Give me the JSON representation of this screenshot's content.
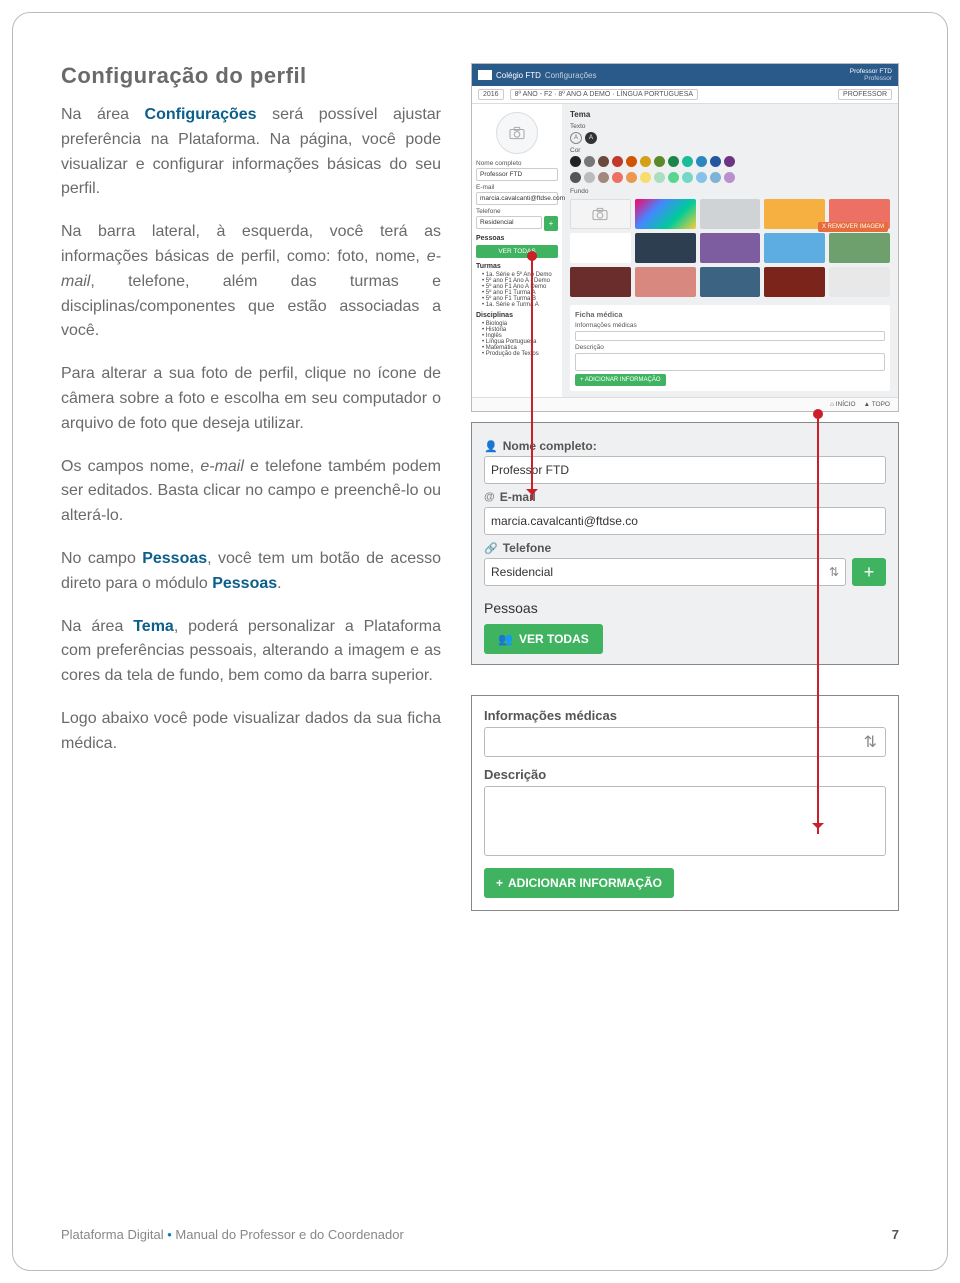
{
  "title": "Configuração do perfil",
  "paragraphs": {
    "p1a": "Na área ",
    "p1_hl": "Configurações",
    "p1b": " será possível ajustar preferência na Plataforma. Na página, você pode visualizar e configurar informações básicas do seu perfil.",
    "p2a": "Na barra lateral, à esquerda, você terá as informações básicas de perfil, como: foto, nome, ",
    "p2_it": "e-mail",
    "p2b": ", telefone, além das turmas e disciplinas/componentes que estão associadas a você.",
    "p3": "Para alterar a sua foto de perfil, clique no ícone de câmera sobre a foto e escolha em seu computador o arquivo de foto que deseja utilizar.",
    "p4a": "Os campos nome, ",
    "p4_it": "e-mail",
    "p4b": " e telefone também podem ser editados. Basta clicar no campo e preenchê-lo ou alterá-lo.",
    "p5a": "No campo ",
    "p5_hl1": "Pessoas",
    "p5b": ", você tem um botão de acesso direto para o módulo ",
    "p5_hl2": "Pessoas",
    "p5c": ".",
    "p6a": "Na área ",
    "p6_hl": "Tema",
    "p6b": ", poderá personalizar a Plataforma com preferências pessoais, alterando a imagem e as cores da tela de fundo, bem como da barra superior.",
    "p7": "Logo abaixo você pode visualizar dados da sua ficha médica."
  },
  "app": {
    "brand": "Colégio FTD",
    "breadcrumb": "Configurações",
    "user": "Professor FTD",
    "role_sub": "Professor",
    "year_pill": "2016",
    "class_pill": "8º ANO - F2 · 8º ANO A DEMO · LÍNGUA PORTUGUESA",
    "role_pill": "PROFESSOR",
    "side": {
      "nome_label": "Nome completo",
      "nome_value": "Professor FTD",
      "email_label": "E-mail",
      "email_value": "marcia.cavalcanti@ftdse.com",
      "tel_label": "Telefone",
      "tel_value": "Residencial",
      "pessoas_title": "Pessoas",
      "ver_todas": "VER TODAS",
      "turmas_title": "Turmas",
      "turmas": [
        "1a. Série e 5º Ano Demo",
        "5º ano F1 Ano A - Demo",
        "5º ano F1 Ano A Demo",
        "5º ano F1 Turma A",
        "5º ano F1 Turma B",
        "1a. Série e Turma A"
      ],
      "disciplinas_title": "Disciplinas",
      "disciplinas": [
        "Biologia",
        "História",
        "Inglês",
        "Língua Portuguesa",
        "Matemática",
        "Produção de Textos"
      ]
    },
    "main": {
      "tema_title": "Tema",
      "texto_label": "Texto",
      "size_a": "A",
      "size_b": "A",
      "cor_label": "Cor",
      "fundo_label": "Fundo",
      "remove_img": "X REMOVER IMAGEM",
      "ficha_title": "Ficha médica",
      "info_label": "Informações médicas",
      "desc_label": "Descrição",
      "add_info": "+ ADICIONAR INFORMAÇÃO",
      "inicio": "INÍCIO",
      "topo": "TOPO"
    },
    "colors_row1": [
      "#222",
      "#777",
      "#6a4a3a",
      "#c0392b",
      "#d35400",
      "#d4a017",
      "#5a8a2a",
      "#1e8449",
      "#1abc9c",
      "#2e86c1",
      "#2456a0",
      "#6c3483"
    ],
    "colors_row2": [
      "#555",
      "#bbb",
      "#a1887f",
      "#ec7063",
      "#eb984e",
      "#f7dc6f",
      "#a9dfbf",
      "#58d68d",
      "#76d7c4",
      "#85c1e9",
      "#7fb3d5",
      "#bb8fce"
    ],
    "bg_tiles": [
      "camera",
      "poly",
      "#d0d3d6",
      "#f5b041",
      "#ec7063",
      "#fff",
      "#2c3e50",
      "#7e5ca0",
      "#5dade2",
      "#6ea06e",
      "#6b2c2c",
      "#d98880",
      "#3c6382",
      "#7b241c",
      "#e8e8e8"
    ]
  },
  "zoom1": {
    "nome_label": "Nome completo:",
    "nome_value": "Professor FTD",
    "email_label": "E-mail",
    "email_value": "marcia.cavalcanti@ftdse.co",
    "tel_label": "Telefone",
    "tel_value": "Residencial",
    "pessoas_title": "Pessoas",
    "ver_todas_icon": "👥",
    "ver_todas": "VER TODAS"
  },
  "zoom2": {
    "info_label": "Informações médicas",
    "desc_label": "Descrição",
    "add_info": "ADICIONAR INFORMAÇÃO"
  },
  "footer": {
    "left_a": "Plataforma Digital",
    "dot": "•",
    "left_b": "Manual do Professor e do Coordenador",
    "page": "7"
  }
}
